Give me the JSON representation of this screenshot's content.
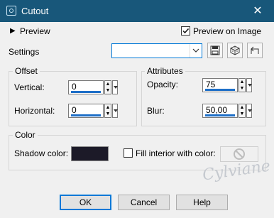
{
  "window": {
    "title": "Cutout",
    "close_glyph": "✕"
  },
  "preview": {
    "label": "Preview",
    "toggle_glyph": "▶",
    "on_image_label": "Preview on Image",
    "on_image_checked": true
  },
  "settings": {
    "label": "Settings",
    "preset_value": "",
    "icons": [
      "save-preset-icon",
      "randomize-icon",
      "reset-icon"
    ]
  },
  "offset": {
    "group_label": "Offset",
    "vertical_label": "Vertical:",
    "vertical_value": "0",
    "horizontal_label": "Horizontal:",
    "horizontal_value": "0"
  },
  "attributes": {
    "group_label": "Attributes",
    "opacity_label": "Opacity:",
    "opacity_value": "75",
    "blur_label": "Blur:",
    "blur_value": "50,00"
  },
  "color": {
    "group_label": "Color",
    "shadow_label": "Shadow color:",
    "shadow_color": "#1c1a28",
    "fill_label": "Fill interior with color:",
    "fill_checked": false
  },
  "watermark": {
    "text": "Cylviane"
  },
  "buttons": {
    "ok": "OK",
    "cancel": "Cancel",
    "help": "Help"
  },
  "colors": {
    "titlebar": "#18577a",
    "accent": "#1e6fc8"
  }
}
